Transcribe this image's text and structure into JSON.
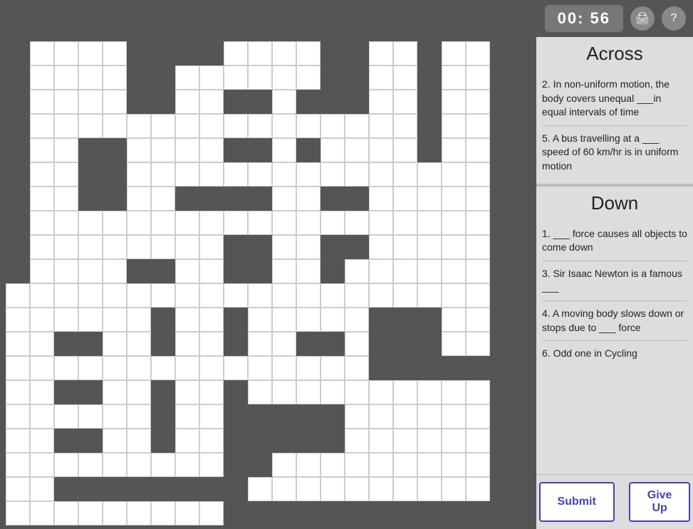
{
  "timer": {
    "display": "00: 56"
  },
  "icons": {
    "print": "🖨",
    "help": "?"
  },
  "across": {
    "header": "Across",
    "clues": [
      {
        "number": 2,
        "text": "In non-uniform motion, the body covers unequal ___in equal intervals of time"
      },
      {
        "number": 5,
        "text": "A bus travelling at a ___ speed of 60 km/hr is in uniform motion"
      }
    ]
  },
  "down": {
    "header": "Down",
    "clues": [
      {
        "number": 1,
        "text": "___ force causes all objects to come down"
      },
      {
        "number": 3,
        "text": "Sir Isaac Newton is a famous ___"
      },
      {
        "number": 4,
        "text": "A moving body slows down or stops due to ___ force"
      },
      {
        "number": 6,
        "text": "Odd one in Cycling"
      }
    ]
  },
  "buttons": {
    "submit": "Submit",
    "give_up": "Give Up"
  },
  "grid": {
    "rows": 20,
    "cols": 20
  }
}
